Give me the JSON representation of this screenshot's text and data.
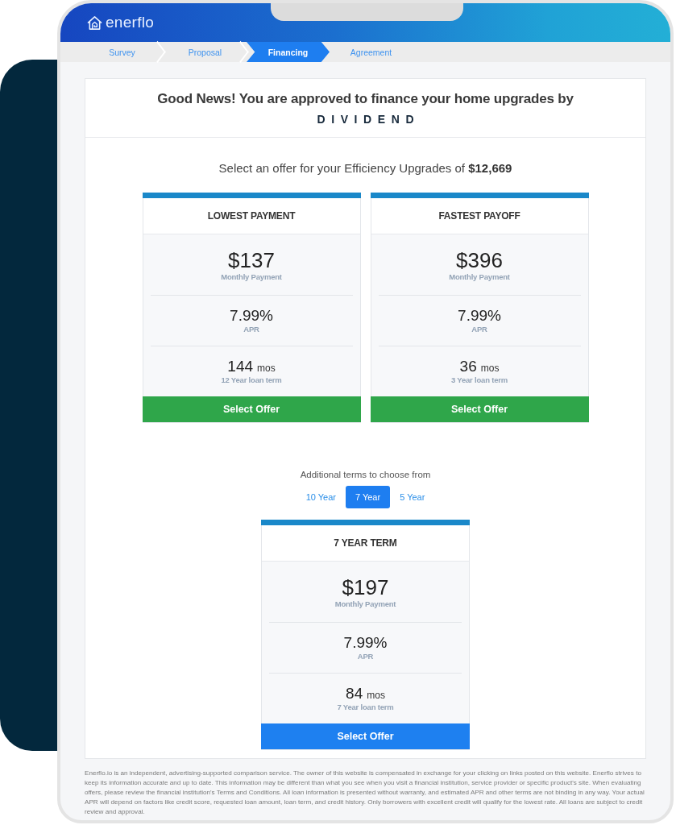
{
  "header": {
    "logo_text": "enerflo"
  },
  "steps": [
    {
      "label": "Survey",
      "selected": false
    },
    {
      "label": "Proposal",
      "selected": false
    },
    {
      "label": "Financing",
      "selected": true
    },
    {
      "label": "Agreement",
      "selected": false
    }
  ],
  "approval": {
    "title": "Good News! You are approved to finance your home upgrades by",
    "lender_logo": "DIVIDEND"
  },
  "offer_prompt": "Select an offer for your Efficiency Upgrades of **$12,669**",
  "offers": [
    {
      "title": "LOWEST PAYMENT",
      "payment": "$137",
      "payment_label": "Monthly Payment",
      "apr": "7.99%",
      "apr_label": "APR",
      "term": "144",
      "term_unit": "mos",
      "term_label": "12 Year loan term",
      "button": "Select Offer"
    },
    {
      "title": "FASTEST PAYOFF",
      "payment": "$396",
      "payment_label": "Monthly Payment",
      "apr": "7.99%",
      "apr_label": "APR",
      "term": "36",
      "term_unit": "mos",
      "term_label": "3 Year loan term",
      "button": "Select Offer"
    }
  ],
  "additional_terms": {
    "label": "Additional terms to choose from",
    "tabs": [
      {
        "label": "10 Year",
        "selected": false
      },
      {
        "label": "7 Year",
        "selected": true
      },
      {
        "label": "5 Year",
        "selected": false
      }
    ],
    "offer": {
      "title": "7 YEAR TERM",
      "payment": "$197",
      "payment_label": "Monthly Payment",
      "apr": "7.99%",
      "apr_label": "APR",
      "term": "84",
      "term_unit": "mos",
      "term_label": "7 Year loan term",
      "button": "Select Offer"
    }
  },
  "disclaimer": "Enerflo.io is an independent, advertising-supported comparison service. The owner of this website is compensated in exchange for your clicking on links posted on this website. Enerflo strives to keep its information accurate and up to date. This information may be different than what you see when you visit a financial institution, service provider or specific product's site. When evaluating offers, please review the financial institution's Terms and Conditions. All loan information is presented without warranty, and estimated APR and other terms are not binding in any way. Your actual APR will depend on factors like credit score, requested loan amount, loan term, and credit history. Only borrowers with excellent credit will qualify for the lowest rate. All loans are subject to credit review and approval."
}
